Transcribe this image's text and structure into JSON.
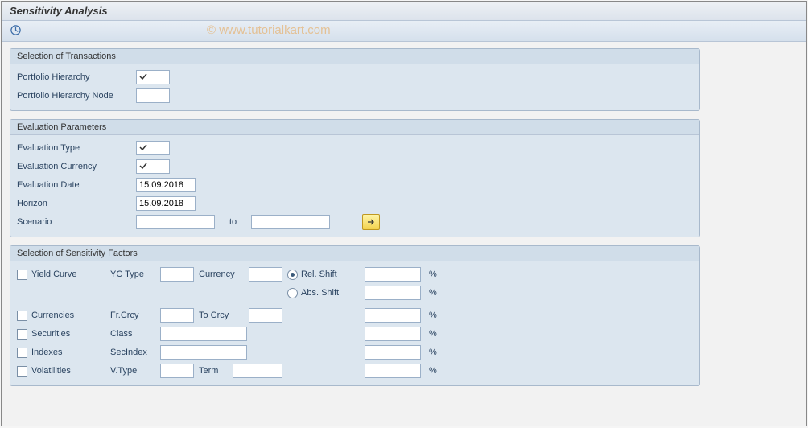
{
  "title": "Sensitivity Analysis",
  "watermark": "© www.tutorialkart.com",
  "g1": {
    "title": "Selection of Transactions",
    "portfolio_hierarchy_label": "Portfolio Hierarchy",
    "portfolio_hierarchy_value": "",
    "portfolio_node_label": "Portfolio Hierarchy Node",
    "portfolio_node_value": ""
  },
  "g2": {
    "title": "Evaluation Parameters",
    "eval_type_label": "Evaluation Type",
    "eval_type_value": "",
    "eval_curr_label": "Evaluation Currency",
    "eval_curr_value": "",
    "eval_date_label": "Evaluation Date",
    "eval_date_value": "15.09.2018",
    "horizon_label": "Horizon",
    "horizon_value": "15.09.2018",
    "scenario_label": "Scenario",
    "scenario_from": "",
    "to_label": "to",
    "scenario_to": ""
  },
  "g3": {
    "title": "Selection of Sensitivity Factors",
    "yield_curve_label": "Yield Curve",
    "yc_type_label": "YC Type",
    "yc_type_value": "",
    "currency_label": "Currency",
    "currency_value": "",
    "rel_shift_label": "Rel. Shift",
    "rel_shift_value": "",
    "abs_shift_label": "Abs. Shift",
    "abs_shift_value": "",
    "currencies_label": "Currencies",
    "frcrcy_label": "Fr.Crcy",
    "frcrcy_value": "",
    "tocrcy_label": "To Crcy",
    "tocrcy_value": "",
    "currencies_shift": "",
    "securities_label": "Securities",
    "class_label": "Class",
    "class_value": "",
    "securities_shift": "",
    "indexes_label": "Indexes",
    "secindex_label": "SecIndex",
    "secindex_value": "",
    "indexes_shift": "",
    "volatilities_label": "Volatilities",
    "vtype_label": "V.Type",
    "vtype_value": "",
    "term_label": "Term",
    "term_value": "",
    "volatilities_shift": "",
    "pct": "%"
  }
}
